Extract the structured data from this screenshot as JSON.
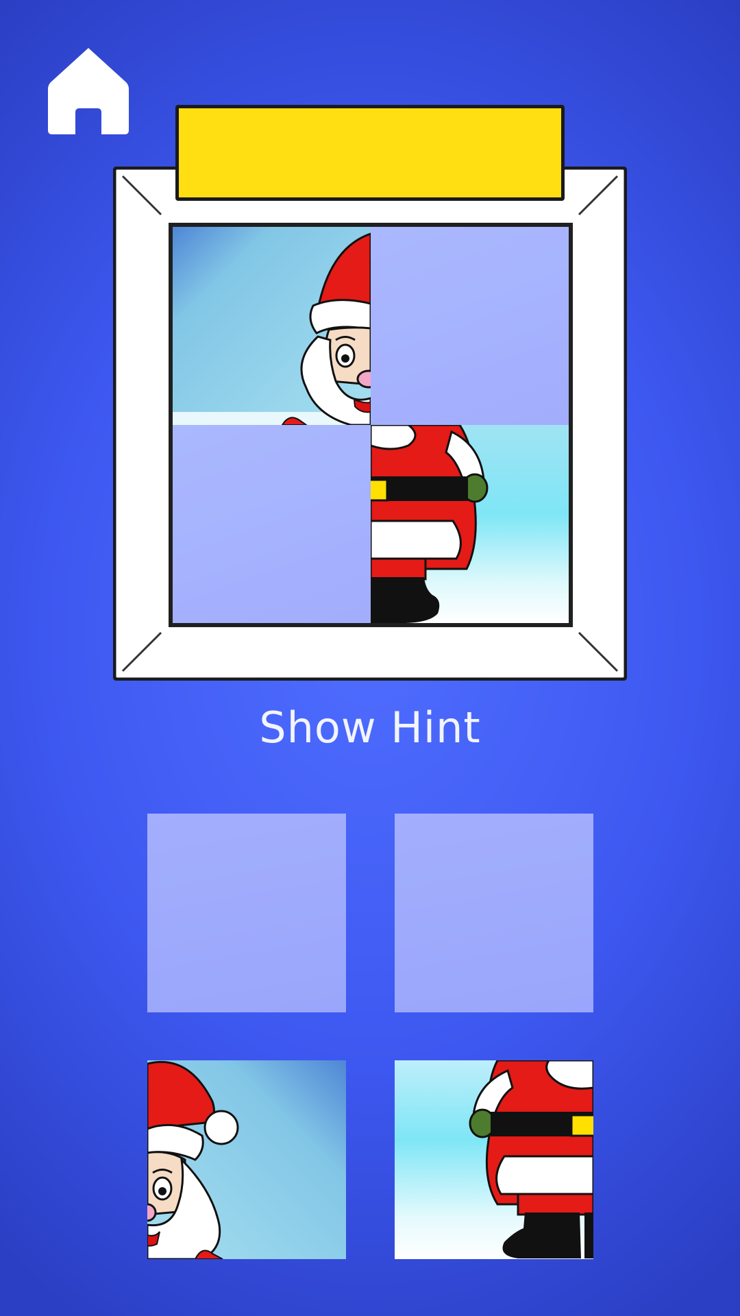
{
  "hint": {
    "label": "Show Hint"
  },
  "home": {
    "icon": "home-icon"
  },
  "nameplate": {
    "color": "#ffde12"
  },
  "puzzle": {
    "grid": "2x2",
    "board": [
      {
        "position": "top-left",
        "piece": "santa-head-left"
      },
      {
        "position": "top-right",
        "piece": null
      },
      {
        "position": "bottom-left",
        "piece": null
      },
      {
        "position": "bottom-right",
        "piece": "santa-body-right"
      }
    ],
    "tray": [
      {
        "slot": "top-left",
        "piece": null
      },
      {
        "slot": "top-right",
        "piece": null
      },
      {
        "slot": "bottom-left",
        "piece": "santa-head-right"
      },
      {
        "slot": "bottom-right",
        "piece": "santa-body-left"
      }
    ]
  }
}
